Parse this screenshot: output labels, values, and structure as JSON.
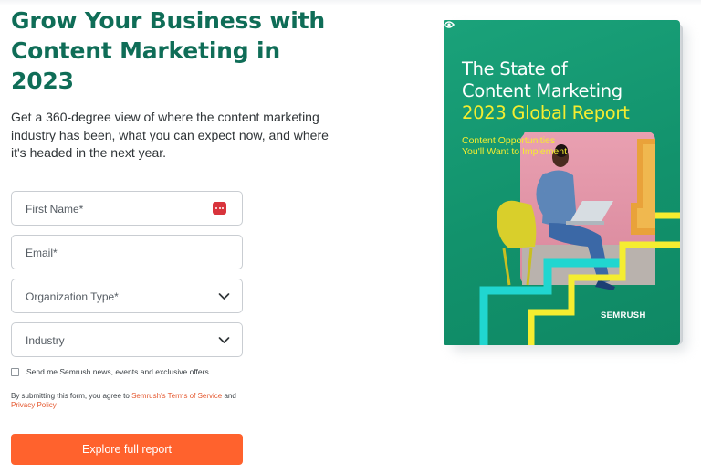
{
  "hero": {
    "headline": "Grow Your Business with Content Marketing in 2023",
    "intro": "Get a 360-degree view of where the content marketing industry has been, what you can expect now, and where it's headed in the next year."
  },
  "form": {
    "first_name_placeholder": "First Name*",
    "email_placeholder": "Email*",
    "org_type_placeholder": "Organization Type*",
    "industry_placeholder": "Industry",
    "consent_label": "Send me Semrush news, events and exclusive offers",
    "legal_prefix": "By submitting this form, you agree to ",
    "terms_link": "Semrush's Terms of Service",
    "legal_and": " and ",
    "privacy_link": "Privacy Policy",
    "submit_label": "Explore full report"
  },
  "report_cover": {
    "title_line1": "The State of",
    "title_line2": "Content Marketing",
    "title_line3": "2023 Global Report",
    "subtitle": "Content Opportunities You'll Want to Implement",
    "brand": "SEMRUSH"
  },
  "colors": {
    "headline": "#0f6d57",
    "cta": "#ff622d",
    "link": "#e4572e",
    "cover_green": "#12926c",
    "cover_yellow": "#f5ed30",
    "cover_cyan": "#20d6d0",
    "photo_pink": "#e58fa3"
  },
  "icons": {
    "password_manager": "password-manager-icon",
    "dropdown": "chevron-down-icon",
    "brand": "semrush-logo-icon"
  }
}
